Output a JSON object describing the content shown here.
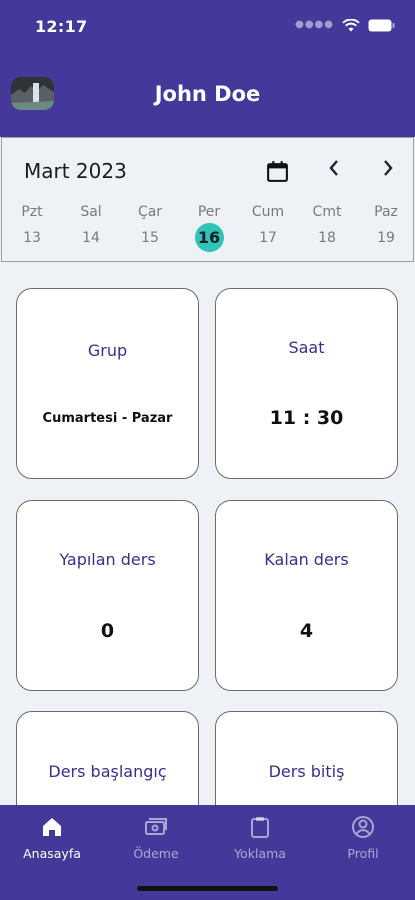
{
  "status_bar": {
    "time": "12:17"
  },
  "header": {
    "user_name": "John Doe"
  },
  "calendar": {
    "month_year": "Mart 2023",
    "days": [
      {
        "name": "Pzt",
        "date": "13"
      },
      {
        "name": "Sal",
        "date": "14"
      },
      {
        "name": "Çar",
        "date": "15"
      },
      {
        "name": "Per",
        "date": "16",
        "selected": true
      },
      {
        "name": "Cum",
        "date": "17"
      },
      {
        "name": "Cmt",
        "date": "18"
      },
      {
        "name": "Paz",
        "date": "19"
      }
    ]
  },
  "cards": [
    {
      "label": "Grup",
      "value": "Cumartesi - Pazar"
    },
    {
      "label": "Saat",
      "value": "11 : 30"
    },
    {
      "label": "Yapılan ders",
      "value": "0"
    },
    {
      "label": "Kalan ders",
      "value": "4"
    },
    {
      "label": "Ders başlangıç",
      "value": ""
    },
    {
      "label": "Ders bitiş",
      "value": ""
    }
  ],
  "bottom_nav": [
    {
      "label": "Anasayfa",
      "icon": "home-icon",
      "active": true
    },
    {
      "label": "Ödeme",
      "icon": "payment-icon"
    },
    {
      "label": "Yoklama",
      "icon": "clipboard-icon"
    },
    {
      "label": "Profil",
      "icon": "user-circle-icon"
    }
  ],
  "colors": {
    "primary": "#44399a",
    "accent": "#2ec4b6",
    "card_label": "#3a2f8c",
    "background": "#eef1f6"
  }
}
